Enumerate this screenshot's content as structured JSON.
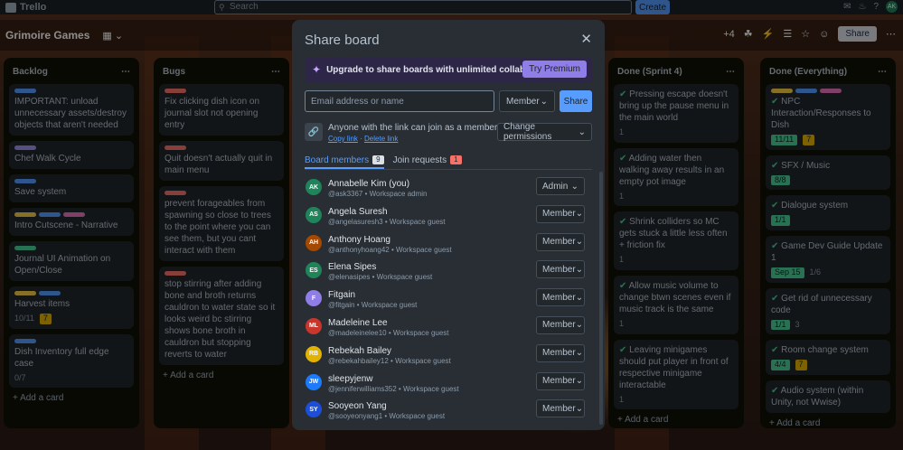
{
  "topbar": {
    "app_name": "Trello",
    "search_placeholder": "Search",
    "create_label": "Create",
    "user_initials": "AK"
  },
  "board": {
    "title": "Grimoire Games",
    "more_count": "+4",
    "share_label": "Share"
  },
  "columns": [
    {
      "title": "Backlog",
      "cards": [
        "IMPORTANT: unload unnecessary assets/destroy objects that aren't needed",
        "Chef Walk Cycle",
        "Save system",
        "Intro Cutscene - Narrative",
        "Journal UI Animation on Open/Close",
        "Harvest items",
        "Dish Inventory full edge case"
      ],
      "meta": {
        "harvest_checklist": "10/11",
        "harvest_count": "7",
        "dish_checklist": "0/7"
      },
      "add": "Add a card"
    },
    {
      "title": "Bugs",
      "cards": [
        "Fix clicking dish icon on journal slot not opening entry",
        "Quit doesn't actually quit in main menu",
        "prevent forageables from spawning so close to trees to the point where you can see them, but you cant interact with them",
        "stop stirring after adding bone and broth returns cauldron to water state so it looks weird bc stirring shows bone broth in cauldron but stopping reverts to water"
      ],
      "add": "Add a card"
    },
    {
      "title": "Done (Sprint 4)",
      "cards": [
        "Pressing escape doesn't bring up the pause menu in the main world",
        "Adding water then walking away results in an empty pot image",
        "Shrink colliders so MC gets stuck a little less often + friction fix",
        "Allow music volume to change btwn scenes even if music track is the same",
        "Leaving minigames should put player in front of respective minigame interactable"
      ],
      "counts": [
        "1",
        "1",
        "1",
        "1",
        "1"
      ],
      "add": "Add a card"
    },
    {
      "title": "Done (Everything)",
      "cards": [
        "NPC Interaction/Responses to Dish",
        "SFX / Music",
        "Dialogue system",
        "Game Dev Guide Update 1",
        "Get rid of unnecessary code",
        "Room change system",
        "Audio system (within Unity, not Wwise)"
      ],
      "meta": {
        "npc_check": "11/11",
        "npc_count": "7",
        "sfx_check": "8/8",
        "dialog_check": "1/1",
        "gdd_date": "Sep 15",
        "gdd_check": "1/6",
        "code_check": "1/1",
        "code_count": "3",
        "room_check": "4/4",
        "room_count": "7"
      },
      "add": "Add a card"
    }
  ],
  "modal": {
    "title": "Share board",
    "upgrade_text": "Upgrade to share boards with unlimited collaborators!",
    "premium_label": "Try Premium",
    "email_placeholder": "Email address or name",
    "role_label": "Member",
    "share_label": "Share",
    "link_text": "Anyone with the link can join as a member",
    "copy_link": "Copy link",
    "link_sep": " · ",
    "delete_link": "Delete link",
    "change_permissions": "Change permissions",
    "tabs": [
      {
        "label": "Board members",
        "count": "9"
      },
      {
        "label": "Join requests",
        "count": "1"
      }
    ],
    "members": [
      {
        "initials": "AK",
        "name": "Annabelle Kim (you)",
        "sub": "@ask3367 • Workspace admin",
        "role": "Admin",
        "color": "#1f845a"
      },
      {
        "initials": "AS",
        "name": "Angela Suresh",
        "sub": "@angelasuresh3 • Workspace guest",
        "role": "Member",
        "color": "#1f845a"
      },
      {
        "initials": "AH",
        "name": "Anthony Hoang",
        "sub": "@anthonyhoang42 • Workspace guest",
        "role": "Member",
        "color": "#a54800"
      },
      {
        "initials": "ES",
        "name": "Elena Sipes",
        "sub": "@elenasipes • Workspace guest",
        "role": "Member",
        "color": "#1f845a"
      },
      {
        "initials": "F",
        "name": "Fitgain",
        "sub": "@fitgain • Workspace guest",
        "role": "Member",
        "color": "#8f7ee7"
      },
      {
        "initials": "ML",
        "name": "Madeleine Lee",
        "sub": "@madeleinelee10 • Workspace guest",
        "role": "Member",
        "color": "#c9372c"
      },
      {
        "initials": "RB",
        "name": "Rebekah Bailey",
        "sub": "@rebekahbailey12 • Workspace guest",
        "role": "Member",
        "color": "#e2b203"
      },
      {
        "initials": "JW",
        "name": "sleepyjenw",
        "sub": "@jenniferwilliams352 • Workspace guest",
        "role": "Member",
        "color": "#1d7afc"
      },
      {
        "initials": "SY",
        "name": "Sooyeon Yang",
        "sub": "@sooyeonyang1 • Workspace guest",
        "role": "Member",
        "color": "#1d4ed8"
      }
    ]
  }
}
